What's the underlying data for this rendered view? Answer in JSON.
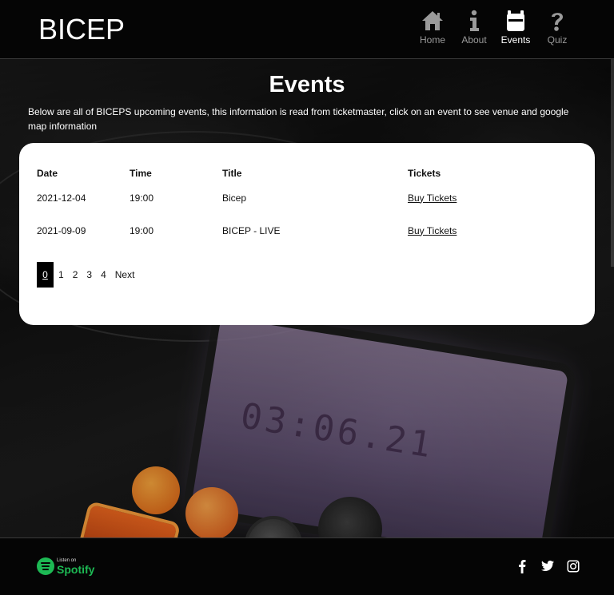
{
  "brand": "BICEP",
  "nav": [
    {
      "label": "Home",
      "icon": "home-icon"
    },
    {
      "label": "About",
      "icon": "info-icon"
    },
    {
      "label": "Events",
      "icon": "calendar-icon",
      "active": true
    },
    {
      "label": "Quiz",
      "icon": "question-icon"
    }
  ],
  "page": {
    "title": "Events",
    "intro": "Below are all of BICEPS upcoming events, this information is read from ticketmaster, click on an event to see venue and google map information"
  },
  "events_table": {
    "headers": [
      "Date",
      "Time",
      "Title",
      "Tickets"
    ],
    "rows": [
      {
        "date": "2021-12-04",
        "time": "19:00",
        "title": "Bicep",
        "tickets": "Buy Tickets"
      },
      {
        "date": "2021-09-09",
        "time": "19:00",
        "title": "BICEP - LIVE",
        "tickets": "Buy Tickets"
      }
    ]
  },
  "pagination": {
    "pages": [
      "0",
      "1",
      "2",
      "3",
      "4"
    ],
    "active": "0",
    "next_label": "Next"
  },
  "footer": {
    "spotify_small": "Listen on",
    "spotify_big": "Spotify",
    "social_icons": [
      "facebook-icon",
      "twitter-icon",
      "instagram-icon"
    ]
  },
  "colors": {
    "header_bg": "#050505",
    "accent_spotify": "#1db954",
    "card_bg": "#ffffff",
    "active_page_bg": "#000000",
    "inactive_nav": "#9a9a9a"
  }
}
